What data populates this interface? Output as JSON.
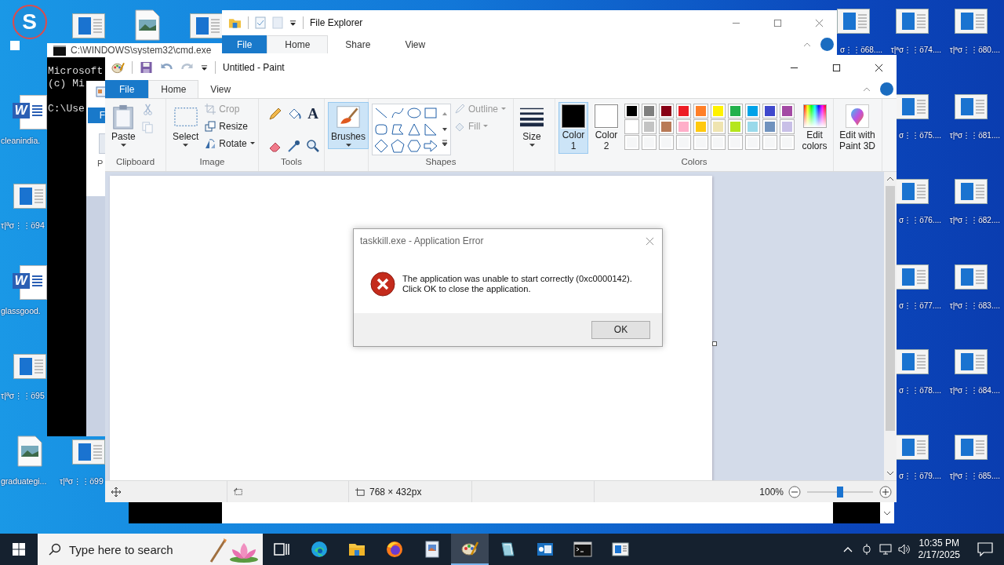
{
  "desktop_left": [
    {
      "icons": [
        {
          "kind": "skype",
          "glyph": "S"
        },
        {
          "kind": "word",
          "glyph": "W",
          "label": "cleanindia."
        },
        {
          "kind": "window",
          "label": "τ|ªσ⋮⋮ö94"
        },
        {
          "kind": "word",
          "glyph": "W",
          "label": "glassgood."
        },
        {
          "kind": "window",
          "label": "τ|ªσ⋮⋮ö95"
        },
        {
          "kind": "image",
          "label": "graduategi..."
        }
      ]
    },
    {
      "icons": [
        {
          "kind": "window"
        },
        {
          "kind": "empty"
        },
        {
          "kind": "empty"
        },
        {
          "kind": "empty"
        },
        {
          "kind": "empty"
        },
        {
          "kind": "window",
          "label": "τ|ªσ⋮⋮ö99"
        }
      ]
    },
    {
      "icons": [
        {
          "kind": "image"
        }
      ]
    },
    {
      "icons": [
        {
          "kind": "window"
        }
      ]
    }
  ],
  "desktop_right": [
    {
      "icons": [
        {
          "kind": "window",
          "label": "σ⋮⋮ö68...."
        }
      ]
    },
    {
      "icons": [
        {
          "kind": "window",
          "label": "τ|ªσ⋮⋮ö74...."
        },
        {
          "kind": "window",
          "label": "σ⋮⋮ö75...."
        },
        {
          "kind": "window",
          "label": "σ⋮⋮ö76...."
        },
        {
          "kind": "window",
          "label": "σ⋮⋮ö77...."
        },
        {
          "kind": "window",
          "label": "σ⋮⋮ö78...."
        },
        {
          "kind": "window",
          "label": "σ⋮⋮ö79...."
        }
      ]
    },
    {
      "icons": [
        {
          "kind": "window",
          "label": "τ|ªσ⋮⋮ö80...."
        },
        {
          "kind": "window",
          "label": "τ|ªσ⋮⋮ö81...."
        },
        {
          "kind": "window",
          "label": "τ|ªσ⋮⋮ö82...."
        },
        {
          "kind": "window",
          "label": "τ|ªσ⋮⋮ö83...."
        },
        {
          "kind": "window",
          "label": "τ|ªσ⋮⋮ö84...."
        },
        {
          "kind": "window",
          "label": "τ|ªσ⋮⋮ö85...."
        }
      ]
    }
  ],
  "cmd_window": {
    "title": "C:\\WINDOWS\\system32\\cmd.exe",
    "lines": [
      "Microsoft",
      "(c) Mi",
      "C:\\Use"
    ]
  },
  "back_window": {
    "tab": "F",
    "ribbon_label": "P"
  },
  "explorer": {
    "title": "File Explorer",
    "tabs": [
      {
        "label": "File",
        "kind": "file",
        "selected": false
      },
      {
        "label": "Home",
        "kind": "tab",
        "selected": true
      },
      {
        "label": "Share",
        "kind": "tab",
        "selected": false
      },
      {
        "label": "View",
        "kind": "tab",
        "selected": false
      }
    ]
  },
  "paint": {
    "title": "Untitled - Paint",
    "tabs": [
      {
        "label": "File",
        "kind": "file",
        "selected": false
      },
      {
        "label": "Home",
        "kind": "tab",
        "selected": true
      },
      {
        "label": "View",
        "kind": "tab",
        "selected": false
      }
    ],
    "clipboard": {
      "label": "Clipboard",
      "paste": "Paste",
      "cut_disabled": true,
      "copy_disabled": true
    },
    "image": {
      "label": "Image",
      "select": "Select",
      "commands": [
        {
          "kind": "crop",
          "label": "Crop",
          "disabled": true
        },
        {
          "kind": "resize",
          "label": "Resize",
          "disabled": false
        },
        {
          "kind": "rotate",
          "label": "Rotate",
          "disabled": false
        }
      ]
    },
    "tools": {
      "label": "Tools",
      "items": [
        {
          "kind": "pencil"
        },
        {
          "kind": "fill"
        },
        {
          "kind": "text",
          "glyph": "A"
        },
        {
          "kind": "eraser"
        },
        {
          "kind": "picker"
        },
        {
          "kind": "magnifier"
        }
      ]
    },
    "brushes": {
      "label": "Brushes",
      "selected": true
    },
    "shapes": {
      "label": "Shapes",
      "items": [
        {
          "kind": "line"
        },
        {
          "kind": "curve"
        },
        {
          "kind": "oval"
        },
        {
          "kind": "rect"
        },
        {
          "kind": "roundrect"
        },
        {
          "kind": "polygon"
        },
        {
          "kind": "triangle"
        },
        {
          "kind": "right-triangle"
        },
        {
          "kind": "diamond"
        },
        {
          "kind": "pentagon"
        },
        {
          "kind": "hexagon"
        },
        {
          "kind": "arrow"
        }
      ],
      "outline": {
        "label": "Outline",
        "disabled": true
      },
      "fill": {
        "label": "Fill",
        "disabled": true
      }
    },
    "size": {
      "label": "Size"
    },
    "colors": {
      "label": "Colors",
      "color1": {
        "label": "Color 1",
        "color": "#000000",
        "selected": true
      },
      "color2": {
        "label": "Color 2",
        "color": "#ffffff",
        "selected": false
      },
      "palette": [
        {
          "color": "#000000"
        },
        {
          "color": "#7f7f7f"
        },
        {
          "color": "#880015"
        },
        {
          "color": "#ed1c24"
        },
        {
          "color": "#ff7f27"
        },
        {
          "color": "#fff200"
        },
        {
          "color": "#22b14c"
        },
        {
          "color": "#00a2e8"
        },
        {
          "color": "#3f48cc"
        },
        {
          "color": "#a349a4"
        },
        {
          "color": "#ffffff"
        },
        {
          "color": "#c3c3c3"
        },
        {
          "color": "#b97a57"
        },
        {
          "color": "#ffaec9"
        },
        {
          "color": "#ffc90e"
        },
        {
          "color": "#efe4b0"
        },
        {
          "color": "#b5e61d"
        },
        {
          "color": "#99d9ea"
        },
        {
          "color": "#7092be"
        },
        {
          "color": "#c8bfe7"
        }
      ],
      "edit": "Edit colors"
    },
    "paint3d": {
      "label": "Edit with Paint 3D"
    },
    "status": {
      "dimensions": "768 × 432px",
      "zoom": "100%",
      "zoom_slider": {
        "level": 0.5
      }
    }
  },
  "dialog": {
    "title": "taskkill.exe - Application Error",
    "message": "The application was unable to start correctly (0xc0000142).\nClick OK to close the application.",
    "button": "OK"
  },
  "taskbar": {
    "search": {
      "placeholder": "Type here to search"
    },
    "apps": [
      {
        "kind": "taskview",
        "selected": false
      },
      {
        "kind": "edge",
        "selected": false
      },
      {
        "kind": "explorer",
        "selected": false
      },
      {
        "kind": "firefox",
        "selected": false
      },
      {
        "kind": "viewer",
        "selected": false
      },
      {
        "kind": "paint",
        "selected": true
      },
      {
        "kind": "glass",
        "selected": false
      },
      {
        "kind": "mail",
        "selected": false
      },
      {
        "kind": "cmd",
        "selected": false
      },
      {
        "kind": "window",
        "selected": false
      }
    ],
    "time": "10:35 PM",
    "date": "2/17/2025"
  }
}
